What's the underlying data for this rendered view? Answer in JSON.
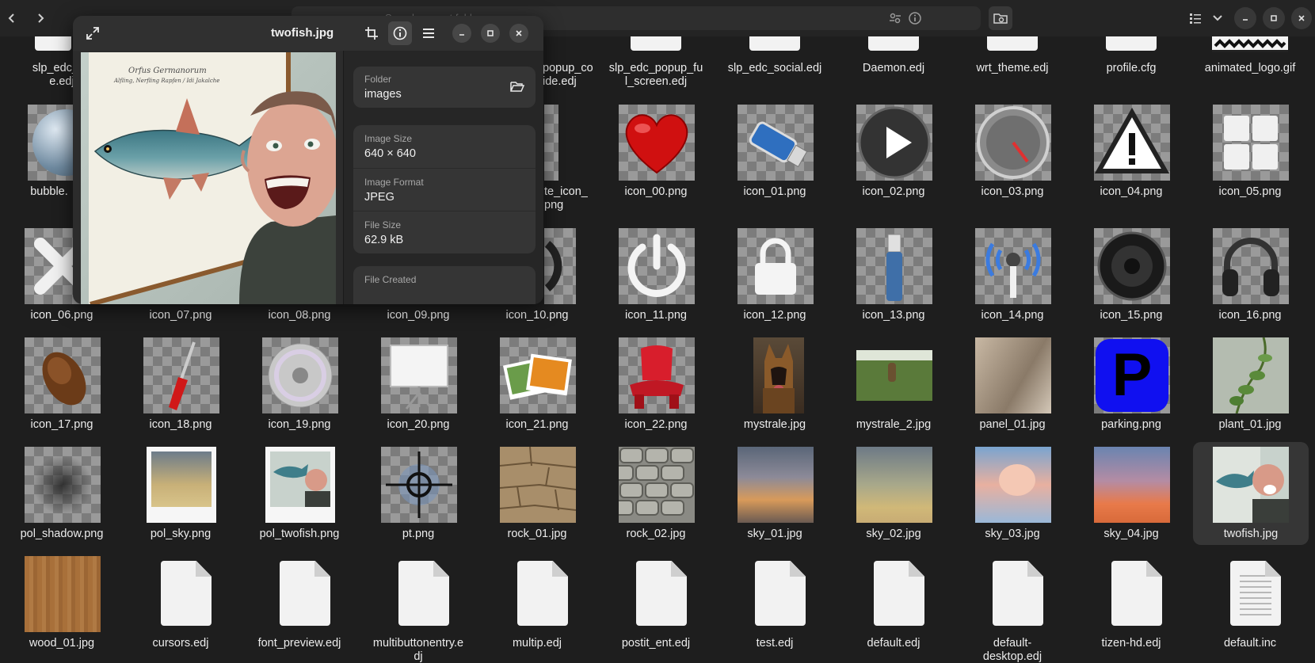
{
  "header": {
    "search_placeholder": "Search current folder"
  },
  "viewer": {
    "title": "twofish.jpg",
    "painting_caption_line1": "Orfus Germanorum",
    "painting_caption_line2": "Alfling, Nerfling   Rapfen / Idi Jakalche",
    "properties": {
      "folder_key": "Folder",
      "folder_val": "images",
      "size_key": "Image Size",
      "size_val": "640 × 640",
      "format_key": "Image Format",
      "format_val": "JPEG",
      "filesize_key": "File Size",
      "filesize_val": "62.9 kB",
      "created_key": "File Created"
    }
  },
  "files": {
    "row0": [
      {
        "label": "slp_edc_he\ne.edj"
      },
      {
        "label": "popup_co\nide.edj"
      },
      {
        "label": "slp_edc_popup_fu\nl_screen.edj"
      },
      {
        "label": "slp_edc_social.edj"
      },
      {
        "label": "Daemon.edj"
      },
      {
        "label": "wrt_theme.edj"
      },
      {
        "label": "profile.cfg"
      },
      {
        "label": "animated_logo.gif"
      }
    ],
    "row1": [
      {
        "label": "bubble."
      },
      {
        "label": "te_icon_\npng"
      },
      {
        "label": "icon_00.png"
      },
      {
        "label": "icon_01.png"
      },
      {
        "label": "icon_02.png"
      },
      {
        "label": "icon_03.png"
      },
      {
        "label": "icon_04.png"
      },
      {
        "label": "icon_05.png"
      }
    ],
    "row2": [
      {
        "label": "icon_06.png"
      },
      {
        "label": "icon_07.png"
      },
      {
        "label": "icon_08.png"
      },
      {
        "label": "icon_09.png"
      },
      {
        "label": "icon_10.png"
      },
      {
        "label": "icon_11.png"
      },
      {
        "label": "icon_12.png"
      },
      {
        "label": "icon_13.png"
      },
      {
        "label": "icon_14.png"
      },
      {
        "label": "icon_15.png"
      },
      {
        "label": "icon_16.png"
      }
    ],
    "row3": [
      {
        "label": "icon_17.png"
      },
      {
        "label": "icon_18.png"
      },
      {
        "label": "icon_19.png"
      },
      {
        "label": "icon_20.png"
      },
      {
        "label": "icon_21.png"
      },
      {
        "label": "icon_22.png"
      },
      {
        "label": "mystrale.jpg"
      },
      {
        "label": "mystrale_2.jpg"
      },
      {
        "label": "panel_01.jpg"
      },
      {
        "label": "parking.png"
      },
      {
        "label": "plant_01.jpg"
      }
    ],
    "row4": [
      {
        "label": "pol_shadow.png"
      },
      {
        "label": "pol_sky.png"
      },
      {
        "label": "pol_twofish.png"
      },
      {
        "label": "pt.png"
      },
      {
        "label": "rock_01.jpg"
      },
      {
        "label": "rock_02.jpg"
      },
      {
        "label": "sky_01.jpg"
      },
      {
        "label": "sky_02.jpg"
      },
      {
        "label": "sky_03.jpg"
      },
      {
        "label": "sky_04.jpg"
      },
      {
        "label": "twofish.jpg"
      }
    ],
    "row5": [
      {
        "label": "wood_01.jpg"
      },
      {
        "label": "cursors.edj"
      },
      {
        "label": "font_preview.edj"
      },
      {
        "label": "multibuttonentry.e\ndj"
      },
      {
        "label": "multip.edj"
      },
      {
        "label": "postit_ent.edj"
      },
      {
        "label": "test.edj"
      },
      {
        "label": "default.edj"
      },
      {
        "label": "default-\ndesktop.edj"
      },
      {
        "label": "tizen-hd.edj"
      },
      {
        "label": "default.inc"
      }
    ]
  }
}
